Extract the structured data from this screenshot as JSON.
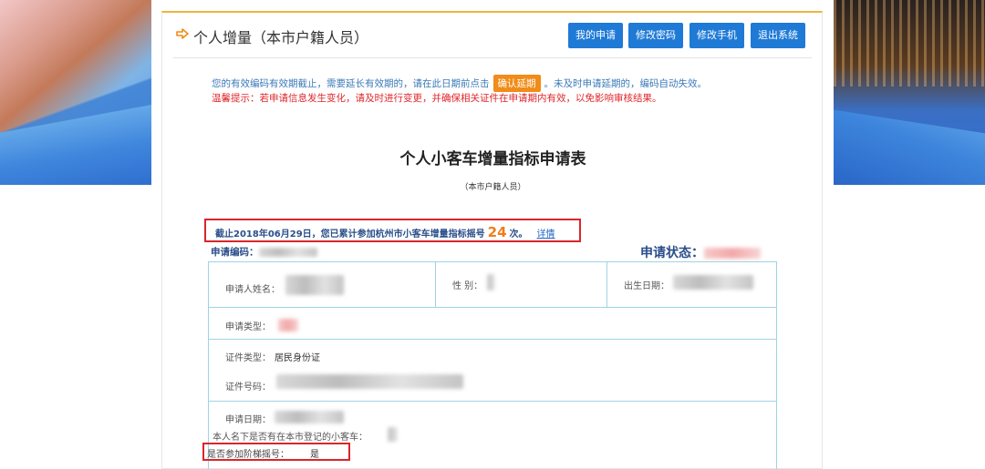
{
  "header": {
    "title": "个人增量（本市户籍人员）",
    "buttons": [
      "我的申请",
      "修改密码",
      "修改手机",
      "退出系统"
    ]
  },
  "notice": {
    "line1_before": "您的有效编码有效期截止，需要延长有效期的，请在此日期前点击",
    "confirm_label": "确认延期",
    "line1_after": "。未及时申请延期的，编码自动失效。",
    "line2": "温馨提示：若申请信息发生变化，请及时进行变更，并确保相关证件在申请期内有效，以免影响审核结果。"
  },
  "form": {
    "title": "个人小客车增量指标申请表",
    "subtitle": "（本市户籍人员）",
    "summary_before": "截止2018年06月29日，您已累计参加杭州市小客车增量指标摇号",
    "summary_count": "24",
    "summary_after": "次。",
    "detail_link": "详情",
    "app_code_label": "申请编码：",
    "status_label": "申请状态："
  },
  "table": {
    "name_label": "申请人姓名：",
    "gender_label": "性 别：",
    "birth_label": "出生日期：",
    "type_label": "申请类型：",
    "id_type_label": "证件类型：",
    "id_type_value": "居民身份证",
    "id_no_label": "证件号码：",
    "date_label": "申请日期：",
    "car_label": "本人名下是否有在本市登记的小客车：",
    "participate_label": "是否参加阶梯摇号：",
    "participate_value": "是"
  },
  "colors": {
    "primary_button": "#1f7ad6",
    "confirm_button": "#f08c18",
    "warning_text": "#e0262a",
    "highlight_border": "#d9262c",
    "count_color": "#f07d1a"
  }
}
